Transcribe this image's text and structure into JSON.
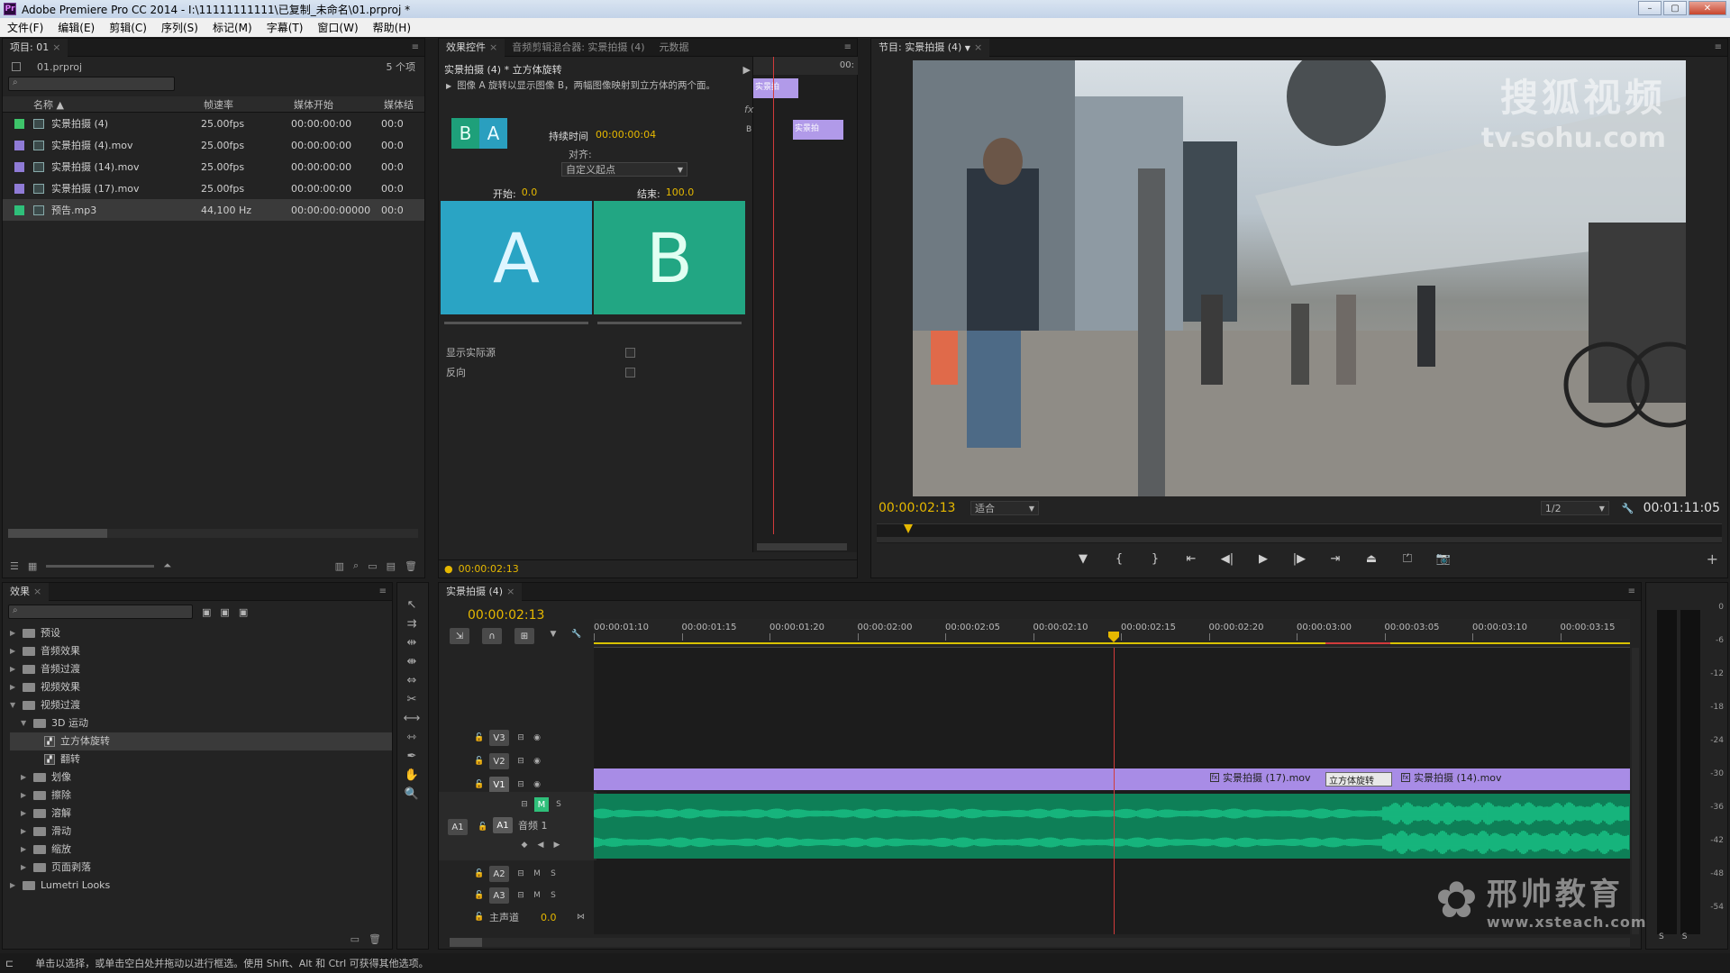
{
  "app": {
    "title": "Adobe Premiere Pro CC 2014 - I:\\11111111111\\已复制_未命名\\01.prproj *",
    "logo": "Pr",
    "window_controls": [
      "–",
      "▢",
      "✕"
    ]
  },
  "menu": [
    "文件(F)",
    "编辑(E)",
    "剪辑(C)",
    "序列(S)",
    "标记(M)",
    "字幕(T)",
    "窗口(W)",
    "帮助(H)"
  ],
  "project_panel": {
    "tab": "项目: 01",
    "file": "01.prproj",
    "count": "5 个项",
    "columns": [
      "名称",
      "帧速率",
      "媒体开始",
      "媒体结"
    ],
    "items": [
      {
        "name": "实景拍摄 (4)",
        "rate": "25.00fps",
        "start": "00:00:00:00",
        "end": "00:0",
        "color": "#3ec46a"
      },
      {
        "name": "实景拍摄 (4).mov",
        "rate": "25.00fps",
        "start": "00:00:00:00",
        "end": "00:0",
        "color": "#8f7bd6"
      },
      {
        "name": "实景拍摄 (14).mov",
        "rate": "25.00fps",
        "start": "00:00:00:00",
        "end": "00:0",
        "color": "#8f7bd6"
      },
      {
        "name": "实景拍摄 (17).mov",
        "rate": "25.00fps",
        "start": "00:00:00:00",
        "end": "00:0",
        "color": "#8f7bd6"
      },
      {
        "name": "预告.mp3",
        "rate": "44,100 Hz",
        "start": "00:00:00:00000",
        "end": "00:0",
        "color": "#2fbf7a"
      }
    ]
  },
  "effect_controls": {
    "tabs": [
      "效果控件",
      "音频剪辑混合器: 实景拍摄 (4)",
      "元数据"
    ],
    "header": "实景拍摄 (4) * 立方体旋转",
    "mini_time": "00:",
    "description": "图像 A 旋转以显示图像 B，两幅图像映射到立方体的两个面。",
    "duration_label": "持续时间",
    "duration_value": "00:00:00:04",
    "align_label": "对齐:",
    "align_value": "自定义起点",
    "start_label": "开始:",
    "start_value": "0.0",
    "end_label": "结束:",
    "end_value": "100.0",
    "thumb_a": "A",
    "thumb_b": "B",
    "small_b": "B",
    "small_a": "A",
    "show_actual_label": "显示实际源",
    "reverse_label": "反向",
    "clip_label_1": "实景拍",
    "clip_label_2": "实景拍",
    "fx_mark": "fx",
    "mini_b": "B",
    "timecode": "00:00:02:13",
    "color_a": "#2aa4c4",
    "color_b": "#22a683"
  },
  "program_monitor": {
    "tab": "节目: 实景拍摄 (4)",
    "timecode": "00:00:02:13",
    "fit": "适合",
    "resolution": "1/2",
    "duration": "00:01:11:05",
    "watermark_top": "搜狐视频",
    "watermark_url": "tv.sohu.com"
  },
  "effects_panel": {
    "tab": "效果",
    "tree": [
      {
        "label": "预设",
        "level": 0,
        "kind": "folder",
        "open": false
      },
      {
        "label": "音频效果",
        "level": 0,
        "kind": "folder",
        "open": false
      },
      {
        "label": "音频过渡",
        "level": 0,
        "kind": "folder",
        "open": false
      },
      {
        "label": "视频效果",
        "level": 0,
        "kind": "folder",
        "open": false
      },
      {
        "label": "视频过渡",
        "level": 0,
        "kind": "folder",
        "open": true
      },
      {
        "label": "3D 运动",
        "level": 1,
        "kind": "folder",
        "open": true
      },
      {
        "label": "立方体旋转",
        "level": 2,
        "kind": "fx",
        "selected": true
      },
      {
        "label": "翻转",
        "level": 2,
        "kind": "fx"
      },
      {
        "label": "划像",
        "level": 1,
        "kind": "folder",
        "open": false
      },
      {
        "label": "擦除",
        "level": 1,
        "kind": "folder",
        "open": false
      },
      {
        "label": "溶解",
        "level": 1,
        "kind": "folder",
        "open": false
      },
      {
        "label": "滑动",
        "level": 1,
        "kind": "folder",
        "open": false
      },
      {
        "label": "缩放",
        "level": 1,
        "kind": "folder",
        "open": false
      },
      {
        "label": "页面剥落",
        "level": 1,
        "kind": "folder",
        "open": false
      },
      {
        "label": "Lumetri Looks",
        "level": 0,
        "kind": "folder",
        "open": false
      }
    ]
  },
  "timeline": {
    "tab": "实景拍摄 (4)",
    "timecode": "00:00:02:13",
    "ruler": [
      "00:00:01:10",
      "00:00:01:15",
      "00:00:01:20",
      "00:00:02:00",
      "00:00:02:05",
      "00:00:02:10",
      "00:00:02:15",
      "00:00:02:20",
      "00:00:03:00",
      "00:00:03:05",
      "00:00:03:10",
      "00:00:03:15"
    ],
    "tracks": {
      "v3": "V3",
      "v2": "V2",
      "v1": "V1",
      "a1_src": "A1",
      "a1": "A1",
      "a1_name": "音频 1",
      "a2": "A2",
      "a3": "A3",
      "master": "主声道",
      "master_val": "0.0"
    },
    "clip1": "实景拍摄 (17).mov",
    "transition": "立方体旋转",
    "clip2": "实景拍摄 (14).mov",
    "clip_color": "#a88ce6",
    "audio_color": "#19c788",
    "watermark": "邢帅教育",
    "watermark_url": "www.xsteach.com"
  },
  "meter": {
    "labels": [
      "0",
      "-6",
      "-12",
      "-18",
      "-24",
      "-30",
      "-36",
      "-42",
      "-48",
      "-54"
    ],
    "solo": [
      "S",
      "S"
    ]
  },
  "status": {
    "text": "单击以选择，或单击空白处并拖动以进行框选。使用 Shift、Alt 和 Ctrl 可获得其他选项。"
  }
}
